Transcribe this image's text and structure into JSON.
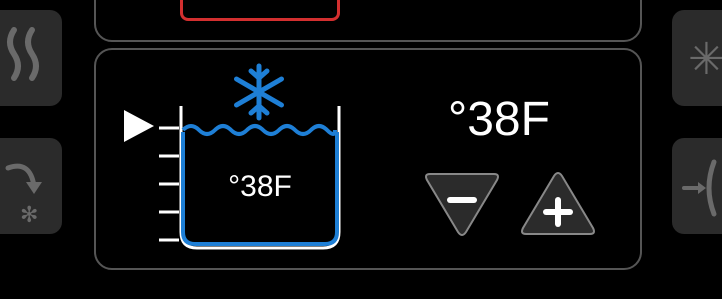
{
  "mode_panel": {
    "icons": [
      "waves-icon",
      "defrost-icon",
      "fan-icon",
      "airflow-icon"
    ]
  },
  "tank": {
    "current_temp": "°38F",
    "icon": "snowflake-icon",
    "level_marker": "play-triangle-icon"
  },
  "setpoint": {
    "value": "°38F",
    "decrease_icon": "minus-icon",
    "increase_icon": "plus-icon"
  },
  "colors": {
    "accent_blue": "#1e7fd6",
    "panel_border": "#555555",
    "side_button": "#2b2b2b",
    "alert_red": "#d32f2f"
  }
}
